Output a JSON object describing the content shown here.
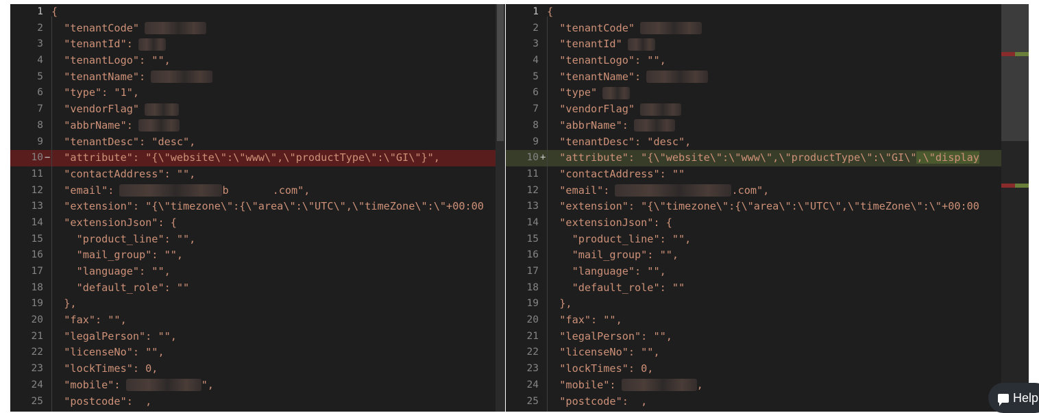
{
  "left": {
    "lines": [
      {
        "n": "1",
        "text": "{"
      },
      {
        "n": "2",
        "text": "  \"tenantCode\"",
        "blur": 90
      },
      {
        "n": "3",
        "text": "  \"tenantId\":",
        "blur": 40
      },
      {
        "n": "4",
        "text": "  \"tenantLogo\": \"\","
      },
      {
        "n": "5",
        "text": "  \"tenantName\":",
        "blur": 90
      },
      {
        "n": "6",
        "text": "  \"type\": \"1\","
      },
      {
        "n": "7",
        "text": "  \"vendorFlag\"",
        "blur": 50
      },
      {
        "n": "8",
        "text": "  \"abbrName\":",
        "blur": 60
      },
      {
        "n": "9",
        "text": "  \"tenantDesc\": \"desc\","
      },
      {
        "n": "10",
        "text": "  \"attribute\": \"{\\\"website\\\":\\\"www\\\",\\\"productType\\\":\\\"GI\\\"}\",",
        "state": "removed",
        "marker": "−"
      },
      {
        "n": "11",
        "text": "  \"contactAddress\": \"\","
      },
      {
        "n": "12",
        "text": "  \"email\":",
        "blur": 150,
        "after": "b       .com\","
      },
      {
        "n": "13",
        "text": "  \"extension\": \"{\\\"timezone\\\":{\\\"area\\\":\\\"UTC\\\",\\\"timeZone\\\":\\\"+00:00"
      },
      {
        "n": "14",
        "text": "  \"extensionJson\": {"
      },
      {
        "n": "15",
        "text": "    \"product_line\": \"\","
      },
      {
        "n": "16",
        "text": "    \"mail_group\": \"\","
      },
      {
        "n": "17",
        "text": "    \"language\": \"\","
      },
      {
        "n": "18",
        "text": "    \"default_role\": \"\""
      },
      {
        "n": "19",
        "text": "  },"
      },
      {
        "n": "20",
        "text": "  \"fax\": \"\","
      },
      {
        "n": "21",
        "text": "  \"legalPerson\": \"\","
      },
      {
        "n": "22",
        "text": "  \"licenseNo\": \"\","
      },
      {
        "n": "23",
        "text": "  \"lockTimes\": 0,"
      },
      {
        "n": "24",
        "text": "  \"mobile\":",
        "blur": 110,
        "after": "\","
      },
      {
        "n": "25",
        "text": "  \"postcode\":",
        "after": "  ,"
      }
    ]
  },
  "right": {
    "lines": [
      {
        "n": "1",
        "text": "{"
      },
      {
        "n": "2",
        "text": "  \"tenantCode\"",
        "blur": 90
      },
      {
        "n": "3",
        "text": "  \"tenantId\"",
        "blur": 40
      },
      {
        "n": "4",
        "text": "  \"tenantLogo\": \"\","
      },
      {
        "n": "5",
        "text": "  \"tenantName\":",
        "blur": 90
      },
      {
        "n": "6",
        "text": "  \"type\"",
        "blur": 40
      },
      {
        "n": "7",
        "text": "  \"vendorFlag\"",
        "blur": 60
      },
      {
        "n": "8",
        "text": "  \"abbrName\":",
        "blur": 60
      },
      {
        "n": "9",
        "text": "  \"tenantDesc\": \"desc\","
      },
      {
        "n": "10",
        "text": "  \"attribute\": \"{\\\"website\\\":\\\"www\\\",\\\"productType\\\":\\\"GI\\\"",
        "hl": ",\\\"display",
        "state": "added",
        "marker": "+"
      },
      {
        "n": "11",
        "text": "  \"contactAddress\": \"\""
      },
      {
        "n": "12",
        "text": "  \"email\":",
        "blur": 170,
        "after": ".com\","
      },
      {
        "n": "13",
        "text": "  \"extension\": \"{\\\"timezone\\\":{\\\"area\\\":\\\"UTC\\\",\\\"timeZone\\\":\\\"+00:00"
      },
      {
        "n": "14",
        "text": "  \"extensionJson\": {"
      },
      {
        "n": "15",
        "text": "    \"product_line\": \"\","
      },
      {
        "n": "16",
        "text": "    \"mail_group\": \"\","
      },
      {
        "n": "17",
        "text": "    \"language\": \"\","
      },
      {
        "n": "18",
        "text": "    \"default_role\": \"\""
      },
      {
        "n": "19",
        "text": "  },"
      },
      {
        "n": "20",
        "text": "  \"fax\": \"\","
      },
      {
        "n": "21",
        "text": "  \"legalPerson\": \"\","
      },
      {
        "n": "22",
        "text": "  \"licenseNo\": \"\","
      },
      {
        "n": "23",
        "text": "  \"lockTimes\": 0,"
      },
      {
        "n": "24",
        "text": "  \"mobile\":",
        "blur": 110,
        "after": ","
      },
      {
        "n": "25",
        "text": "  \"postcode\":",
        "after": "  ,"
      }
    ]
  },
  "help": {
    "label": "Help"
  },
  "colors": {
    "removed": "#5a1d1d",
    "added": "#373d29",
    "editor_bg": "#1e1e1e"
  }
}
